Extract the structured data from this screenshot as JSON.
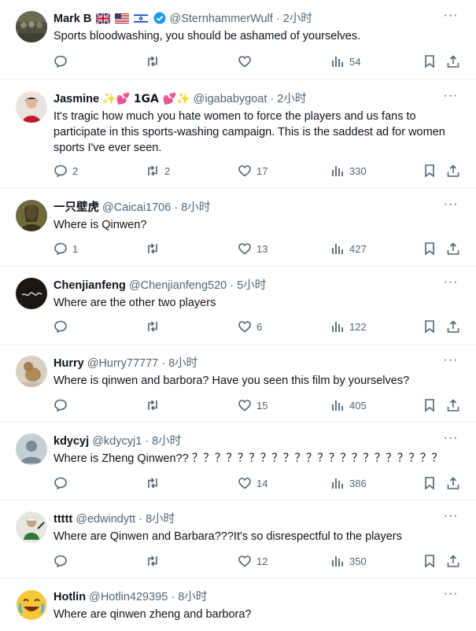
{
  "colors": {
    "text": "#0f1419",
    "secondary": "#536471",
    "verified": "#1d9bf0",
    "divider": "#eff3f4"
  },
  "tweets": [
    {
      "name": "Mark B",
      "name_extras": [
        "uk-flag-icon",
        "us-flag-icon",
        "israel-flag-icon",
        "verified-badge-icon"
      ],
      "handle": "@SternhammerWulf",
      "time": "2小时",
      "text": "Sports bloodwashing, you should be  ashamed of yourselves.",
      "replies": "",
      "retweets": "",
      "likes": "",
      "views": "54"
    },
    {
      "name": "Jasmine",
      "name_suffix": "✨💕 1GA 💕✨",
      "handle": "@igababygoat",
      "time": "2小时",
      "text": "It's tragic how much you hate women to force the players and us fans to participate in this sports-washing campaign. This is the saddest ad for women sports I've ever seen.",
      "replies": "2",
      "retweets": "2",
      "likes": "17",
      "views": "330"
    },
    {
      "name": "一只壁虎",
      "handle": "@Caicai1706",
      "time": "8小时",
      "text": "Where is Qinwen?",
      "replies": "1",
      "retweets": "",
      "likes": "13",
      "views": "427"
    },
    {
      "name": "Chenjianfeng",
      "handle": "@Chenjianfeng520",
      "time": "5小时",
      "text": "Where are the other two players",
      "replies": "",
      "retweets": "",
      "likes": "6",
      "views": "122"
    },
    {
      "name": "Hurry",
      "handle": "@Hurry77777",
      "time": "8小时",
      "text": "Where is qinwen and barbora?  Have you seen this film by yourselves?",
      "replies": "",
      "retweets": "",
      "likes": "15",
      "views": "405"
    },
    {
      "name": "kdycyj",
      "handle": "@kdycyj1",
      "time": "8小时",
      "text": "Where is Zheng Qinwen?? ？？？？？？？？？？？？？？？？？？？？？？",
      "replies": "",
      "retweets": "",
      "likes": "14",
      "views": "386"
    },
    {
      "name": "ttttt",
      "handle": "@edwindytt",
      "time": "8小时",
      "text": "Where are Qinwen and Barbara???It's so disrespectful to the players",
      "replies": "",
      "retweets": "",
      "likes": "12",
      "views": "350"
    },
    {
      "name": "Hotlin",
      "handle": "@Hotlin429395",
      "time": "8小时",
      "text": "Where are qinwen zheng and barbora?",
      "replies": "",
      "retweets": "",
      "likes": "",
      "views": ""
    }
  ],
  "separator": "·",
  "more_glyph": "···"
}
